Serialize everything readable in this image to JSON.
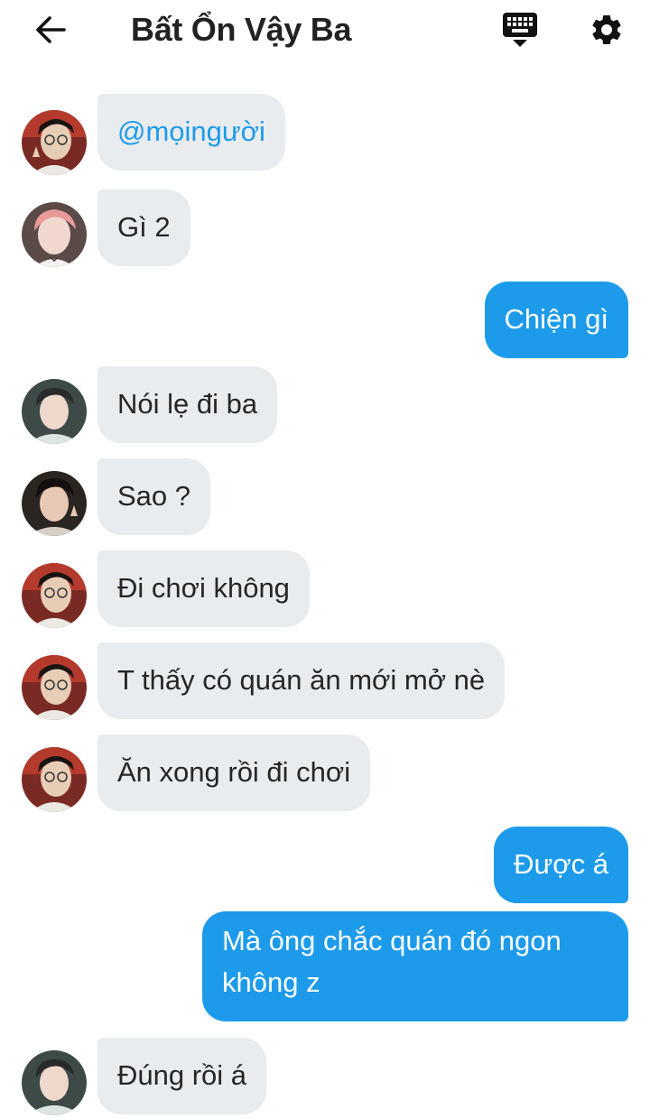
{
  "header": {
    "title": "Bất Ổn Vậy Ba"
  },
  "messages": [
    {
      "side": "in",
      "text": "@mọingười"
    },
    {
      "side": "in",
      "text": "Gì 2"
    },
    {
      "side": "out",
      "text": "Chiện gì"
    },
    {
      "side": "in",
      "text": "Nói lẹ đi ba"
    },
    {
      "side": "in",
      "text": "Sao ?"
    },
    {
      "side": "in",
      "text": "Đi chơi không"
    },
    {
      "side": "in",
      "text": "T thấy có quán ăn mới mở nè"
    },
    {
      "side": "in",
      "text": "Ăn xong rồi đi chơi"
    },
    {
      "side": "out",
      "text": "Được á"
    },
    {
      "side": "out",
      "text": "Mà ông chắc quán đó ngon không z"
    },
    {
      "side": "in",
      "text": "Đúng rồi á"
    }
  ],
  "colors": {
    "incoming_bubble": "#e9ecef",
    "outgoing_bubble": "#1d9bea",
    "mention": "#1d9bea"
  }
}
